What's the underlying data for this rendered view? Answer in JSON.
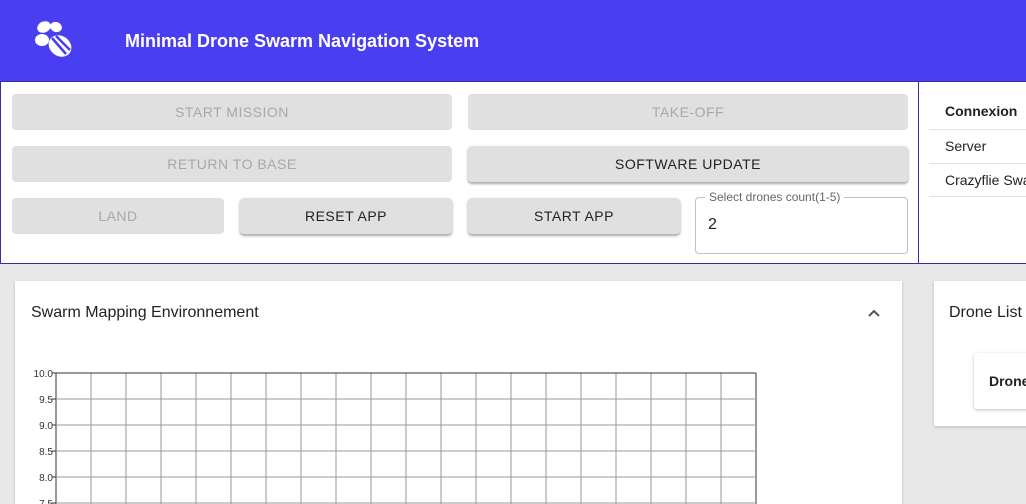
{
  "app": {
    "title": "Minimal Drone Swarm Navigation System",
    "logo_icon": "bee-icon",
    "brand_color": "#4a3ff0"
  },
  "controls": {
    "start_mission": {
      "label": "START MISSION",
      "disabled": true
    },
    "take_off": {
      "label": "TAKE-OFF",
      "disabled": true
    },
    "return_to_base": {
      "label": "RETURN TO BASE",
      "disabled": true
    },
    "software_update": {
      "label": "SOFTWARE UPDATE",
      "disabled": false
    },
    "land": {
      "label": "LAND",
      "disabled": true
    },
    "reset_app": {
      "label": "RESET APP",
      "disabled": false
    },
    "start_app": {
      "label": "START APP",
      "disabled": false
    },
    "drone_count": {
      "label": "Select drones count(1-5)",
      "value": "2"
    }
  },
  "connexion": {
    "header": "Connexion",
    "rows": [
      {
        "label": "Server"
      },
      {
        "label": "Crazyflie Swa"
      }
    ]
  },
  "map": {
    "title": "Swarm Mapping Environnement",
    "collapse_icon": "chevron-up-icon"
  },
  "chart_data": {
    "type": "scatter",
    "title": "",
    "xlabel": "",
    "ylabel": "",
    "y_ticks": [
      "10.0",
      "9.5",
      "9.0",
      "8.5",
      "8.0",
      "7.5"
    ],
    "ylim": [
      7.5,
      10.0
    ],
    "grid": true,
    "series": []
  },
  "drone_list": {
    "title": "Drone List",
    "items": [
      {
        "label": "Drone"
      }
    ]
  }
}
